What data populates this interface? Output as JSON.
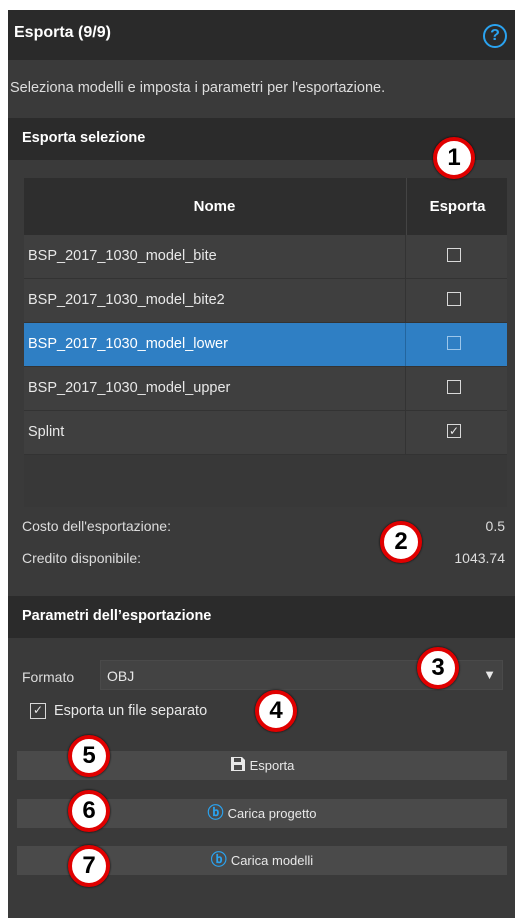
{
  "header": {
    "title": "Esporta (9/9)",
    "help_icon": "help-circle-icon"
  },
  "description": "Seleziona modelli e imposta i parametri per l'esportazione.",
  "export_selection": {
    "title": "Esporta selezione",
    "columns": {
      "name": "Nome",
      "export": "Esporta"
    },
    "rows": [
      {
        "name": "BSP_2017_1030_model_bite",
        "checked": false,
        "selected": false
      },
      {
        "name": "BSP_2017_1030_model_bite2",
        "checked": false,
        "selected": false
      },
      {
        "name": "BSP_2017_1030_model_lower",
        "checked": false,
        "selected": true
      },
      {
        "name": "BSP_2017_1030_model_upper",
        "checked": false,
        "selected": false
      },
      {
        "name": "Splint",
        "checked": true,
        "selected": false
      }
    ],
    "cost_label": "Costo dell'esportazione:",
    "cost_value": "0.5",
    "credit_label": "Credito disponibile:",
    "credit_value": "1043.74"
  },
  "export_params": {
    "title": "Parametri dell’esportazione",
    "format_label": "Formato",
    "format_value": "OBJ",
    "separate_file_label": "Esporta un file separato",
    "separate_file_checked": true
  },
  "buttons": {
    "export": "Esporta",
    "upload_project": "Carica progetto",
    "upload_models": "Carica modelli"
  },
  "callouts": [
    "1",
    "2",
    "3",
    "4",
    "5",
    "6",
    "7"
  ],
  "colors": {
    "accent": "#2aa3f0",
    "selected_row": "#2f7fc4",
    "callout_border": "#e00000"
  }
}
